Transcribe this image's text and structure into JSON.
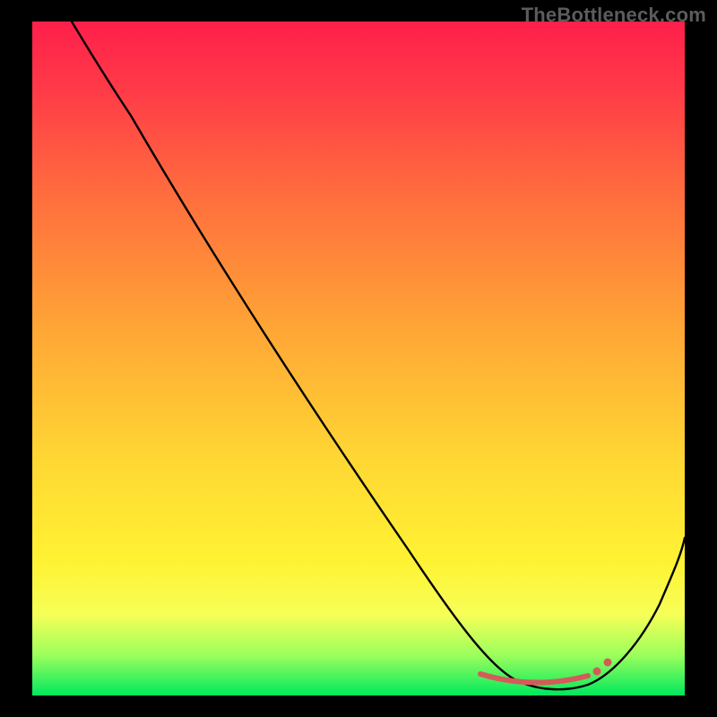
{
  "watermark": "TheBottleneck.com",
  "chart_data": {
    "type": "line",
    "title": "",
    "xlabel": "",
    "ylabel": "",
    "xlim": [
      0,
      100
    ],
    "ylim": [
      0,
      100
    ],
    "grid": false,
    "legend": false,
    "series": [
      {
        "name": "bottleneck-curve",
        "x": [
          6,
          10,
          15,
          20,
          30,
          40,
          50,
          60,
          65,
          70,
          74,
          78,
          82,
          86,
          90,
          95,
          100
        ],
        "y": [
          100,
          95,
          89,
          82,
          68,
          55,
          41,
          28,
          21,
          12,
          5,
          1,
          0.5,
          1,
          4,
          12,
          24
        ]
      }
    ],
    "colors": {
      "curve": "#000000",
      "marker": "#d65a5a",
      "gradient_top": "#ff1f4a",
      "gradient_mid": "#fff233",
      "gradient_bottom": "#00e85e"
    },
    "annotations": {
      "optimal_range_x": [
        68,
        86
      ],
      "optimal_marker_dots_x": [
        86,
        88
      ],
      "marker_y": 2
    }
  }
}
